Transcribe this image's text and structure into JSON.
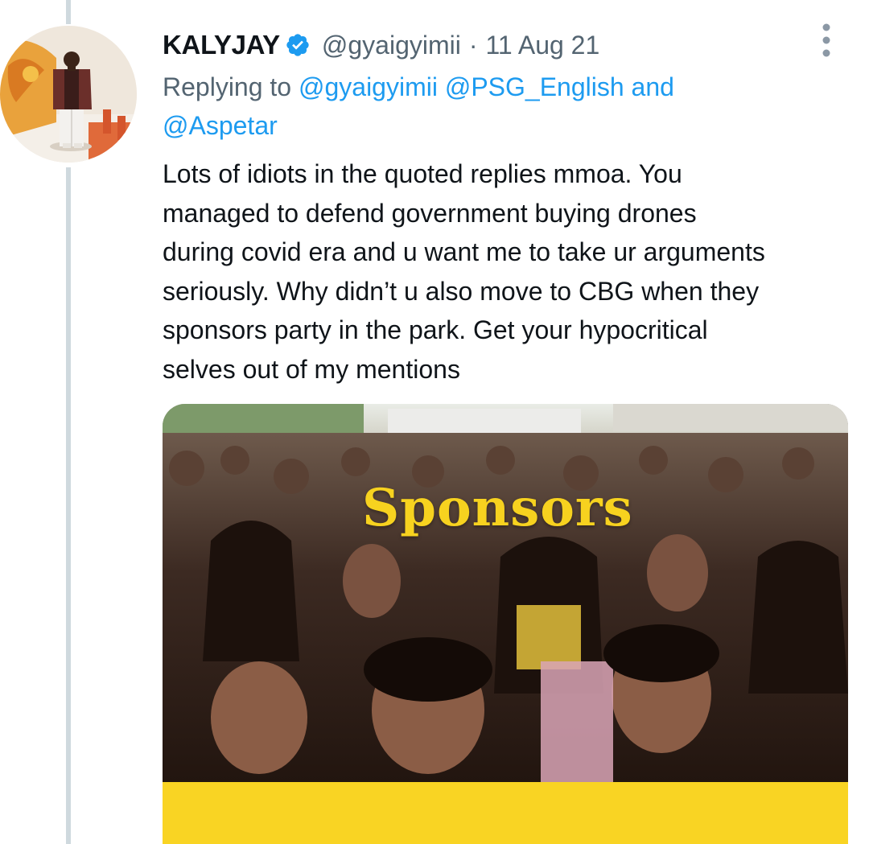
{
  "tweet": {
    "display_name": "KALYJAY",
    "verified": true,
    "handle": "@gyaigyimii",
    "separator": "·",
    "timestamp": "11 Aug 21",
    "reply_prefix": "Replying to",
    "reply_mentions": [
      "@gyaigyimii",
      "@PSG_English"
    ],
    "reply_and": "and",
    "reply_last_mention": "@Aspetar",
    "body_lines": [
      "Lots of idiots in the quoted replies mmoa. You",
      "managed to defend government buying drones",
      "during covid era and u want me to take ur arguments",
      "seriously. Why didn’t u also move to CBG when they",
      "sponsors party in the park. Get your hypocritical",
      "selves out of my mentions"
    ],
    "media": {
      "overlay_text": "Sponsors",
      "band_color": "#f9d423"
    }
  },
  "icons": {
    "verified": "verified-badge-icon",
    "more": "more-options-icon"
  },
  "colors": {
    "accent": "#1d9bf0",
    "text": "#0f1419",
    "muted": "#536471",
    "thread_line": "#cfd9de"
  }
}
